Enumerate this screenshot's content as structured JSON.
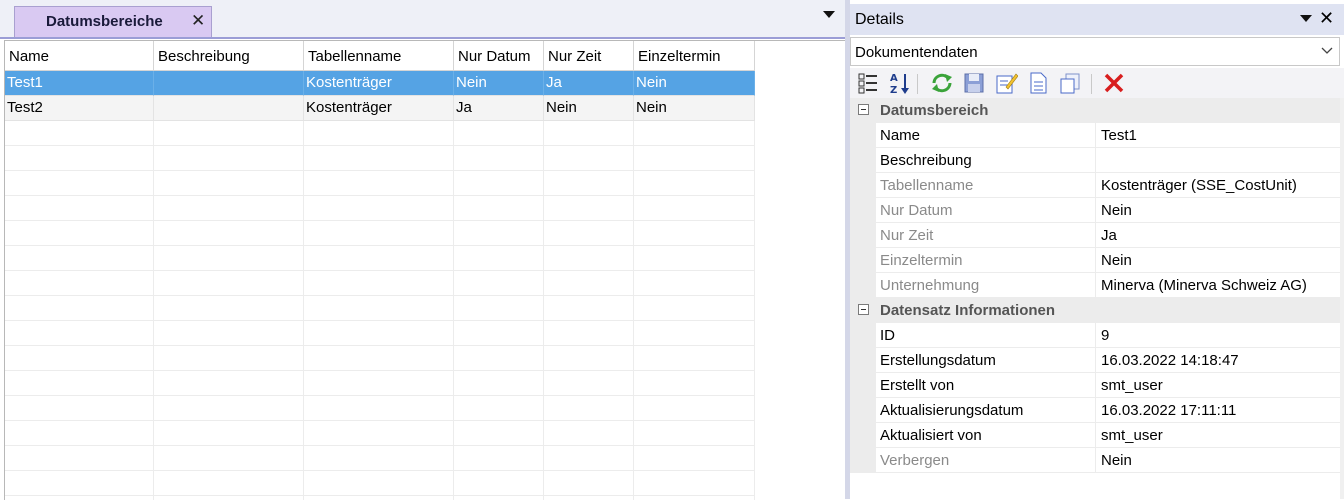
{
  "tab": {
    "title": "Datumsbereiche",
    "close_glyph": "✕"
  },
  "grid": {
    "columns": [
      "Name",
      "Beschreibung",
      "Tabellenname",
      "Nur Datum",
      "Nur Zeit",
      "Einzeltermin"
    ],
    "rows": [
      [
        "Test1",
        "",
        "Kostenträger",
        "Nein",
        "Ja",
        "Nein"
      ],
      [
        "Test2",
        "",
        "Kostenträger",
        "Ja",
        "Nein",
        "Nein"
      ]
    ],
    "selected_row": 0
  },
  "details": {
    "title": "Details",
    "close_glyph": "✕",
    "selector_value": "Dokumentendaten",
    "toolbar_icons": [
      "categorized-icon",
      "sort-alpha-icon",
      "refresh-icon",
      "save-icon",
      "edit-icon",
      "new-document-icon",
      "copy-icon",
      "delete-icon"
    ],
    "categories": [
      {
        "label": "Datumsbereich",
        "props": [
          {
            "name": "Name",
            "value": "Test1",
            "readonly": false
          },
          {
            "name": "Beschreibung",
            "value": "",
            "readonly": false
          },
          {
            "name": "Tabellenname",
            "value": "Kostenträger (SSE_CostUnit)",
            "readonly": true
          },
          {
            "name": "Nur Datum",
            "value": "Nein",
            "readonly": true
          },
          {
            "name": "Nur Zeit",
            "value": "Ja",
            "readonly": true
          },
          {
            "name": "Einzeltermin",
            "value": "Nein",
            "readonly": true
          },
          {
            "name": "Unternehmung",
            "value": "Minerva (Minerva Schweiz AG)",
            "readonly": true
          }
        ]
      },
      {
        "label": "Datensatz Informationen",
        "props": [
          {
            "name": "ID",
            "value": "9",
            "readonly": false
          },
          {
            "name": "Erstellungsdatum",
            "value": "16.03.2022 14:18:47",
            "readonly": false
          },
          {
            "name": "Erstellt von",
            "value": "smt_user",
            "readonly": false
          },
          {
            "name": "Aktualisierungsdatum",
            "value": "16.03.2022 17:11:11",
            "readonly": false
          },
          {
            "name": "Aktualisiert von",
            "value": "smt_user",
            "readonly": false
          },
          {
            "name": "Verbergen",
            "value": "Nein",
            "readonly": true
          }
        ]
      }
    ]
  },
  "colors": {
    "selection": "#55a3e4",
    "tab": "#d9c9f2",
    "panel_header": "#dfe3f2"
  }
}
